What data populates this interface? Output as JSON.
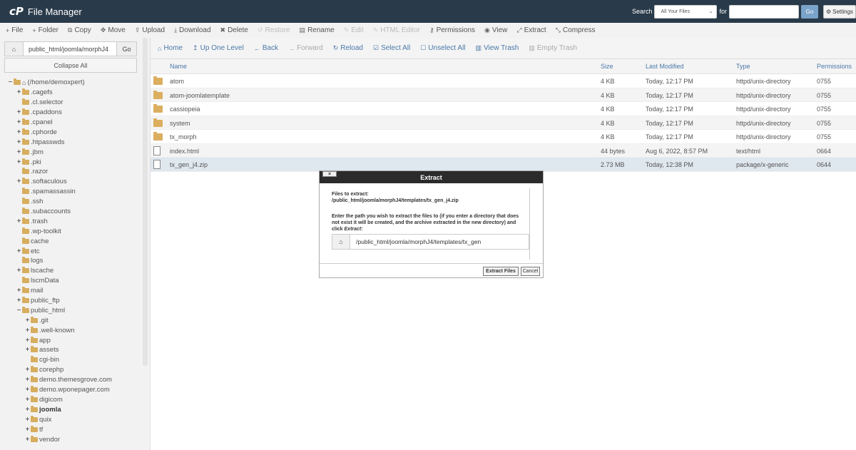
{
  "header": {
    "app_title": "File Manager",
    "logo_text": "cP",
    "search_label": "Search",
    "search_scope": "All Your Files",
    "for_label": "for",
    "search_value": "",
    "go_label": "Go",
    "settings_label": "Settings"
  },
  "toolbar": {
    "items": [
      {
        "label": "File",
        "icon": "plus-icon",
        "glyph": "+",
        "disabled": false
      },
      {
        "label": "Folder",
        "icon": "plus-icon",
        "glyph": "+",
        "disabled": false
      },
      {
        "label": "Copy",
        "icon": "copy-icon",
        "glyph": "⧉",
        "disabled": false
      },
      {
        "label": "Move",
        "icon": "move-icon",
        "glyph": "✥",
        "disabled": false
      },
      {
        "label": "Upload",
        "icon": "upload-icon",
        "glyph": "⇪",
        "disabled": false
      },
      {
        "label": "Download",
        "icon": "download-icon",
        "glyph": "⤓",
        "disabled": false
      },
      {
        "label": "Delete",
        "icon": "delete-icon",
        "glyph": "✖",
        "disabled": false
      },
      {
        "label": "Restore",
        "icon": "restore-icon",
        "glyph": "↺",
        "disabled": true
      },
      {
        "label": "Rename",
        "icon": "rename-icon",
        "glyph": "▤",
        "disabled": false
      },
      {
        "label": "Edit",
        "icon": "edit-icon",
        "glyph": "✎",
        "disabled": true
      },
      {
        "label": "HTML Editor",
        "icon": "html-editor-icon",
        "glyph": "✎",
        "disabled": true
      },
      {
        "label": "Permissions",
        "icon": "key-icon",
        "glyph": "⚷",
        "disabled": false
      },
      {
        "label": "View",
        "icon": "eye-icon",
        "glyph": "◉",
        "disabled": false
      },
      {
        "label": "Extract",
        "icon": "extract-icon",
        "glyph": "⤢",
        "disabled": false
      },
      {
        "label": "Compress",
        "icon": "compress-icon",
        "glyph": "⤡",
        "disabled": false
      }
    ]
  },
  "left": {
    "path_value": "public_html/joomla/morphJ4",
    "go_label": "Go",
    "collapse_label": "Collapse All",
    "tree": [
      {
        "label": "(/home/demoxpert)",
        "indent": 0,
        "toggle": "−",
        "home": true,
        "bold": false
      },
      {
        "label": ".cagefs",
        "indent": 1,
        "toggle": "+",
        "bold": false
      },
      {
        "label": ".cl.selector",
        "indent": 1,
        "toggle": "",
        "bold": false
      },
      {
        "label": ".cpaddons",
        "indent": 1,
        "toggle": "+",
        "bold": false
      },
      {
        "label": ".cpanel",
        "indent": 1,
        "toggle": "+",
        "bold": false
      },
      {
        "label": ".cphorde",
        "indent": 1,
        "toggle": "+",
        "bold": false
      },
      {
        "label": ".htpasswds",
        "indent": 1,
        "toggle": "+",
        "bold": false
      },
      {
        "label": ".jbm",
        "indent": 1,
        "toggle": "+",
        "bold": false
      },
      {
        "label": ".pki",
        "indent": 1,
        "toggle": "+",
        "bold": false
      },
      {
        "label": ".razor",
        "indent": 1,
        "toggle": "",
        "bold": false
      },
      {
        "label": ".softaculous",
        "indent": 1,
        "toggle": "+",
        "bold": false
      },
      {
        "label": ".spamassassin",
        "indent": 1,
        "toggle": "",
        "bold": false
      },
      {
        "label": ".ssh",
        "indent": 1,
        "toggle": "",
        "bold": false
      },
      {
        "label": ".subaccounts",
        "indent": 1,
        "toggle": "",
        "bold": false
      },
      {
        "label": ".trash",
        "indent": 1,
        "toggle": "+",
        "bold": false
      },
      {
        "label": ".wp-toolkit",
        "indent": 1,
        "toggle": "",
        "bold": false
      },
      {
        "label": "cache",
        "indent": 1,
        "toggle": "",
        "bold": false
      },
      {
        "label": "etc",
        "indent": 1,
        "toggle": "+",
        "bold": false
      },
      {
        "label": "logs",
        "indent": 1,
        "toggle": "",
        "bold": false
      },
      {
        "label": "lscache",
        "indent": 1,
        "toggle": "+",
        "bold": false
      },
      {
        "label": "lscmData",
        "indent": 1,
        "toggle": "",
        "bold": false
      },
      {
        "label": "mail",
        "indent": 1,
        "toggle": "+",
        "bold": false
      },
      {
        "label": "public_ftp",
        "indent": 1,
        "toggle": "+",
        "bold": false
      },
      {
        "label": "public_html",
        "indent": 1,
        "toggle": "−",
        "bold": false
      },
      {
        "label": ".git",
        "indent": 2,
        "toggle": "+",
        "bold": false
      },
      {
        "label": ".well-known",
        "indent": 2,
        "toggle": "+",
        "bold": false
      },
      {
        "label": "app",
        "indent": 2,
        "toggle": "+",
        "bold": false
      },
      {
        "label": "assets",
        "indent": 2,
        "toggle": "+",
        "bold": false
      },
      {
        "label": "cgi-bin",
        "indent": 2,
        "toggle": "",
        "bold": false
      },
      {
        "label": "corephp",
        "indent": 2,
        "toggle": "+",
        "bold": false
      },
      {
        "label": "demo.themesgrove.com",
        "indent": 2,
        "toggle": "+",
        "bold": false
      },
      {
        "label": "demo.wponepager.com",
        "indent": 2,
        "toggle": "+",
        "bold": false
      },
      {
        "label": "digicom",
        "indent": 2,
        "toggle": "+",
        "bold": false
      },
      {
        "label": "joomla",
        "indent": 2,
        "toggle": "+",
        "bold": true
      },
      {
        "label": "quix",
        "indent": 2,
        "toggle": "+",
        "bold": false
      },
      {
        "label": "tf",
        "indent": 2,
        "toggle": "+",
        "bold": false
      },
      {
        "label": "vendor",
        "indent": 2,
        "toggle": "+",
        "bold": false
      }
    ]
  },
  "nav": {
    "items": [
      {
        "label": "Home",
        "icon": "home-icon",
        "glyph": "⌂",
        "disabled": false
      },
      {
        "label": "Up One Level",
        "icon": "up-level-icon",
        "glyph": "↥",
        "disabled": false
      },
      {
        "label": "Back",
        "icon": "back-arrow-icon",
        "glyph": "←",
        "disabled": false
      },
      {
        "label": "Forward",
        "icon": "forward-arrow-icon",
        "glyph": "→",
        "disabled": true
      },
      {
        "label": "Reload",
        "icon": "reload-icon",
        "glyph": "↻",
        "disabled": false
      },
      {
        "label": "Select All",
        "icon": "checkbox-checked-icon",
        "glyph": "☑",
        "disabled": false
      },
      {
        "label": "Unselect All",
        "icon": "checkbox-empty-icon",
        "glyph": "☐",
        "disabled": false
      },
      {
        "label": "View Trash",
        "icon": "trash-icon",
        "glyph": "▥",
        "disabled": false
      },
      {
        "label": "Empty Trash",
        "icon": "trash-empty-icon",
        "glyph": "▥",
        "disabled": true
      }
    ]
  },
  "table": {
    "columns": {
      "name": "Name",
      "size": "Size",
      "modified": "Last Modified",
      "type": "Type",
      "perms": "Permissions"
    },
    "rows": [
      {
        "name": "atom",
        "size": "4 KB",
        "modified": "Today, 12:17 PM",
        "type": "httpd/unix-directory",
        "perms": "0755",
        "kind": "folder"
      },
      {
        "name": "atom-joomlatemplate",
        "size": "4 KB",
        "modified": "Today, 12:17 PM",
        "type": "httpd/unix-directory",
        "perms": "0755",
        "kind": "folder"
      },
      {
        "name": "cassiopeia",
        "size": "4 KB",
        "modified": "Today, 12:17 PM",
        "type": "httpd/unix-directory",
        "perms": "0755",
        "kind": "folder"
      },
      {
        "name": "system",
        "size": "4 KB",
        "modified": "Today, 12:17 PM",
        "type": "httpd/unix-directory",
        "perms": "0755",
        "kind": "folder"
      },
      {
        "name": "tx_morph",
        "size": "4 KB",
        "modified": "Today, 12:17 PM",
        "type": "httpd/unix-directory",
        "perms": "0755",
        "kind": "folder"
      },
      {
        "name": "index.html",
        "size": "44 bytes",
        "modified": "Aug 6, 2022, 8:57 PM",
        "type": "text/html",
        "perms": "0664",
        "kind": "file"
      },
      {
        "name": "tx_gen_j4.zip",
        "size": "2.73 MB",
        "modified": "Today, 12:38 PM",
        "type": "package/x-generic",
        "perms": "0644",
        "kind": "zip"
      }
    ]
  },
  "modal": {
    "title": "Extract",
    "close_label": "×",
    "files_heading": "Files to extract:",
    "file_path": "/public_html/joomla/morphJ4/templates/tx_gen_j4.zip",
    "instructions_pre": "Enter the path you wish to extract the files to (if you enter a directory that does not exist it will be created, and the archive extracted in the new directory) and click ",
    "instructions_em": "Extract",
    "instructions_post": ":",
    "path_value": "/public_html/joomla/morphJ4/templates/tx_gen",
    "extract_button": "Extract Files",
    "cancel_button": "Cancel"
  }
}
